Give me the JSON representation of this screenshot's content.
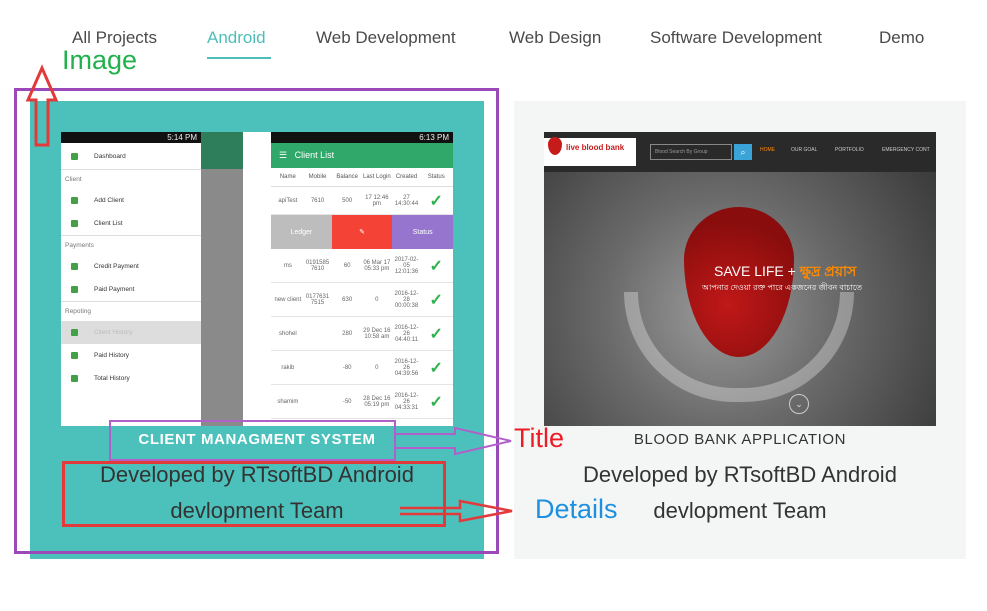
{
  "filters": [
    {
      "label": "All Projects",
      "active": false
    },
    {
      "label": "Android",
      "active": true
    },
    {
      "label": "Web Development",
      "active": false
    },
    {
      "label": "Web Design",
      "active": false
    },
    {
      "label": "Software Development",
      "active": false
    },
    {
      "label": "Demo",
      "active": false
    }
  ],
  "projects": [
    {
      "title": "CLIENT MANAGMENT SYSTEM",
      "details": "Developed by RTsoftBD Android devlopment Team",
      "screenshot": {
        "status_time_left": "5:14 PM",
        "status_time_right": "6:13 PM",
        "drawer": {
          "dashboard": "Dashboard",
          "section_client": "Client",
          "add_client": "Add Client",
          "client_list": "Client List",
          "section_payments": "Payments",
          "credit_payment": "Credit Payment",
          "paid_payment": "Paid Payment",
          "section_reporting": "Repoting",
          "client_history": "Client History",
          "paid_history": "Paid History",
          "total_history": "Total History"
        },
        "app_title": "Client List",
        "columns": [
          "Name",
          "Mobile",
          "Balance",
          "Last Login",
          "Created",
          "Status"
        ],
        "actions": {
          "ledger": "Ledger",
          "status": "Status"
        },
        "rows": [
          {
            "name": "apiTest",
            "mobile": "7610",
            "balance": "500",
            "last": "17 12:46 pm",
            "created": "27 14:30:44"
          },
          {
            "name": "ms",
            "mobile": "0191585 7610",
            "balance": "60",
            "last": "06 Mar 17 05:33 pm",
            "created": "2017-02-05 12:01:36"
          },
          {
            "name": "new client",
            "mobile": "0177631 7515",
            "balance": "630",
            "last": "0",
            "created": "2016-12-28 00:00:38"
          },
          {
            "name": "shohel",
            "mobile": "",
            "balance": "280",
            "last": "29 Dec 16 10:58 am",
            "created": "2016-12-26 04:40:11"
          },
          {
            "name": "rakib",
            "mobile": "",
            "balance": "-80",
            "last": "0",
            "created": "2016-12-26 04:39:56"
          },
          {
            "name": "shamim",
            "mobile": "",
            "balance": "-50",
            "last": "28 Dec 16 05:19 pm",
            "created": "2016-12-26 04:33:31"
          }
        ]
      }
    },
    {
      "title": "BLOOD BANK APPLICATION",
      "details": "Developed by RTsoftBD Android devlopment Team",
      "screenshot": {
        "logo": "live blood bank",
        "search_placeholder": "Blood Search By Group",
        "menu": [
          "HOME",
          "OUR GOAL",
          "PORTFOLIO",
          "EMERGENCY CONT"
        ],
        "slogan_en": "SAVE LIFE +",
        "slogan_bn": "ক্ষুদ্র প্রয়াস",
        "subtitle_bn": "আপনার দেওয়া রক্ত পারে একজনের জীবন বাচাতে"
      }
    }
  ],
  "annotations": {
    "image_label": "Image",
    "title_label": "Title",
    "details_label": "Details",
    "image_color": "#22b14c",
    "title_color": "#ed1c24",
    "details_color": "#1e90e0",
    "box_purple": "#9b49b8",
    "box_red": "#e23a3a"
  },
  "theme": {
    "accent": "#4dbfb8",
    "card_bg": "#4cc1bc"
  }
}
